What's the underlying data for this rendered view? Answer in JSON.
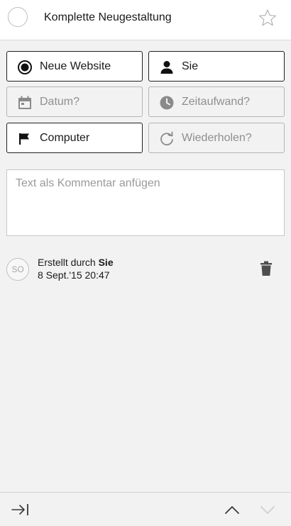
{
  "task": {
    "title": "Komplette Neugestaltung"
  },
  "fields": {
    "project": "Neue Website",
    "assignee": "Sie",
    "date": "Datum?",
    "duration": "Zeitaufwand?",
    "tag": "Computer",
    "repeat": "Wiederholen?"
  },
  "comment": {
    "placeholder": "Text als Kommentar anfügen"
  },
  "activity": {
    "avatar_initials": "SO",
    "created_prefix": "Erstellt durch",
    "created_by": "Sie",
    "date": "8 Sept.'15 20:47"
  },
  "icons": {
    "complete": "circle-check-icon",
    "star": "star-icon",
    "project": "radio-dot-icon",
    "assignee": "person-icon",
    "date": "calendar-icon",
    "duration": "clock-icon",
    "tag": "flag-icon",
    "repeat": "repeat-icon",
    "delete": "trash-icon",
    "collapse": "arrow-to-right-icon",
    "prev": "chevron-up-icon",
    "next": "chevron-down-icon"
  }
}
